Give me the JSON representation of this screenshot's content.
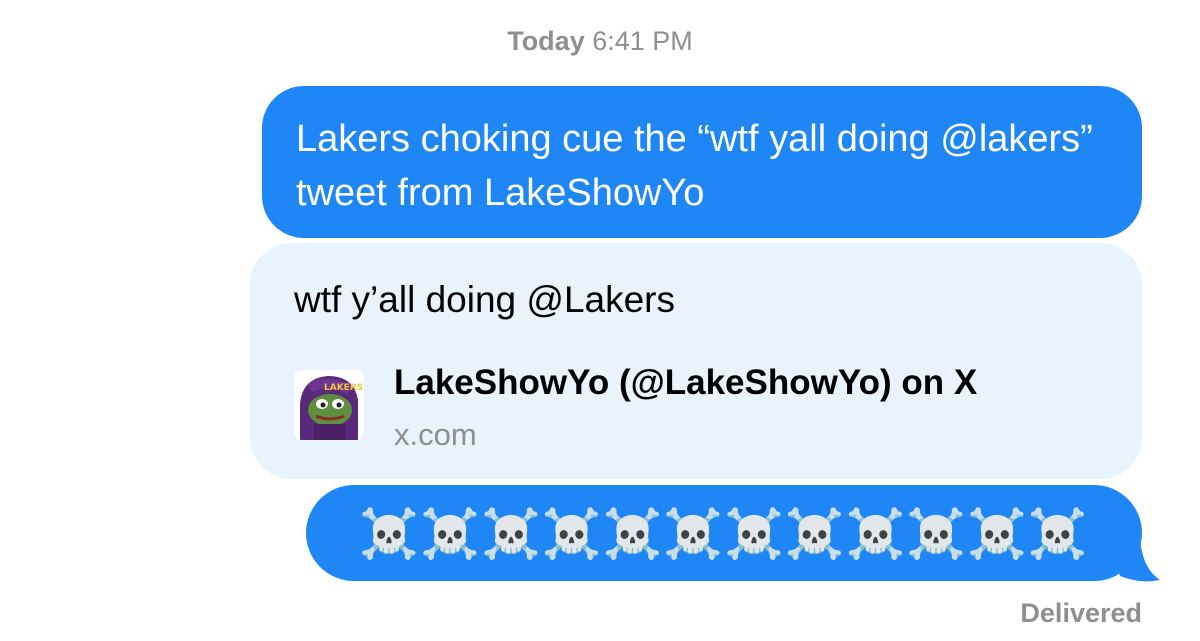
{
  "timestamp": {
    "day": "Today",
    "time": "6:41 PM"
  },
  "messages": [
    {
      "text": "Lakers choking cue the “wtf yall doing @lakers” tweet from LakeShowYo"
    },
    {
      "link_preview": {
        "quote": "wtf y’all doing @Lakers",
        "title": "LakeShowYo (@LakeShowYo) on X",
        "domain": "x.com",
        "avatar_icon": "pepe-lakers-avatar-icon"
      }
    },
    {
      "text": "☠️☠️☠️☠️☠️☠️☠️☠️☠️☠️☠️☠️"
    }
  ],
  "status": {
    "delivered": "Delivered"
  },
  "colors": {
    "sent_bubble": "#1e86f5",
    "link_card": "#e8f3fe",
    "meta_text": "#8e8e93"
  }
}
